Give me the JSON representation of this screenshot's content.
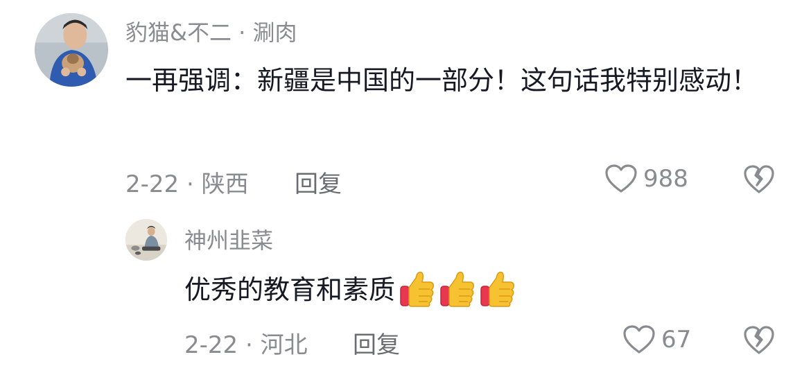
{
  "comments": [
    {
      "username": "豹猫&不二 · 涮肉",
      "text": "一再强调：新疆是中国的一部分！这句话我特别感动！",
      "meta": "2-22 · 陕西",
      "reply_label": "回复",
      "like_count": "988"
    },
    {
      "username": "神州韭菜",
      "text": "优秀的教育和素质",
      "emoji": [
        "thumbs-up",
        "thumbs-up",
        "thumbs-up"
      ],
      "meta": "2-22 · 河北",
      "reply_label": "回复",
      "like_count": "67"
    }
  ],
  "icons": {
    "like": "heart-outline-icon",
    "dislike": "broken-heart-icon"
  },
  "colors": {
    "text": "#161823",
    "secondary": "#8a8b91",
    "reply": "#6b6c72"
  }
}
